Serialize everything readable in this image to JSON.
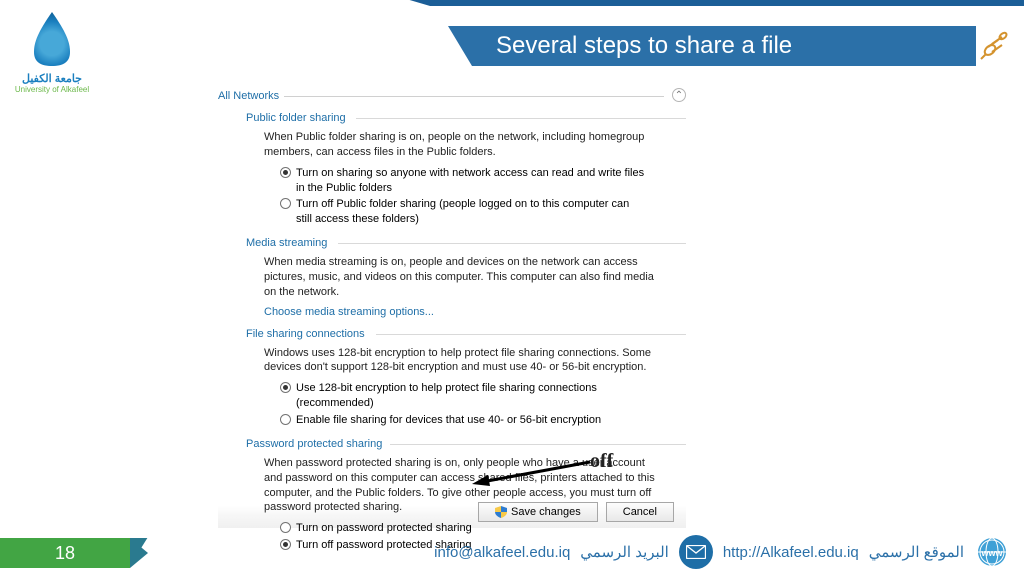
{
  "slide": {
    "title": "Several steps to share a file",
    "page_number": "18"
  },
  "branding": {
    "name_ar": "جامعة الكفيل",
    "name_en": "University of Alkafeel"
  },
  "panel": {
    "all_networks": "All Networks",
    "public_folder": {
      "title": "Public folder sharing",
      "desc": "When Public folder sharing is on, people on the network, including homegroup members, can access files in the Public folders.",
      "opt_on": "Turn on sharing so anyone with network access can read and write files in the Public folders",
      "opt_off": "Turn off Public folder sharing (people logged on to this computer can still access these folders)"
    },
    "media": {
      "title": "Media streaming",
      "desc": "When media streaming is on, people and devices on the network can access pictures, music, and videos on this computer. This computer can also find media on the network.",
      "link": "Choose media streaming options..."
    },
    "encryption": {
      "title": "File sharing connections",
      "desc": "Windows uses 128-bit encryption to help protect file sharing connections. Some devices don't support 128-bit encryption and must use 40- or 56-bit encryption.",
      "opt_128": "Use 128-bit encryption to help protect file sharing connections (recommended)",
      "opt_40": "Enable file sharing for devices that use 40- or 56-bit encryption"
    },
    "password": {
      "title": "Password protected sharing",
      "desc": "When password protected sharing is on, only people who have a user account and password on this computer can access shared files, printers attached to this computer, and the Public folders. To give other people access, you must turn off password protected sharing.",
      "opt_on": "Turn on password protected sharing",
      "opt_off": "Turn off password protected sharing"
    },
    "save": "Save changes",
    "cancel": "Cancel"
  },
  "annotation": {
    "off": "off"
  },
  "footer": {
    "email": "info@alkafeel.edu.iq",
    "email_label_ar": "البريد الرسمي",
    "site": "http://Alkafeel.edu.iq",
    "site_label_ar": "الموقع الرسمي"
  }
}
